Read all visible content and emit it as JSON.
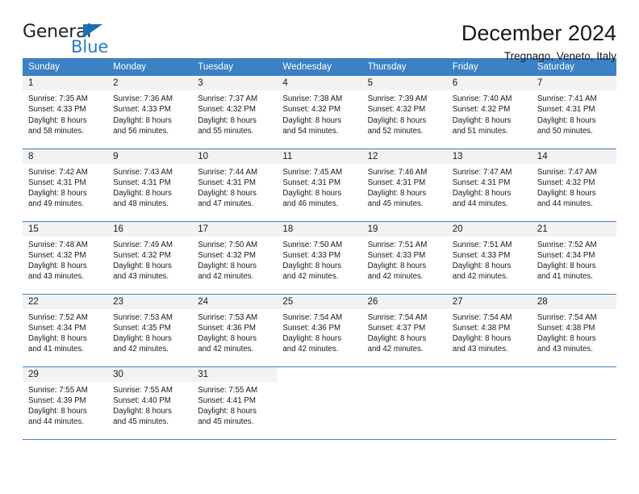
{
  "brand": {
    "name_part1": "General",
    "name_part2": "Blue",
    "triangle_icon": "triangle-icon",
    "accent_color": "#1f7fc4"
  },
  "header": {
    "title": "December 2024",
    "subtitle": "Tregnago, Veneto, Italy"
  },
  "theme": {
    "header_row_bg": "#3b81c4",
    "daynum_bg": "#f2f2f2",
    "grid_line": "#3b81c4",
    "text": "#1a1a1a"
  },
  "columns": [
    "Sunday",
    "Monday",
    "Tuesday",
    "Wednesday",
    "Thursday",
    "Friday",
    "Saturday"
  ],
  "labels": {
    "sunrise_prefix": "Sunrise:",
    "sunset_prefix": "Sunset:",
    "daylight_prefix": "Daylight:"
  },
  "weeks": [
    [
      {
        "day": "1",
        "l1": "Sunrise: 7:35 AM",
        "l2": "Sunset: 4:33 PM",
        "l3": "Daylight: 8 hours",
        "l4": "and 58 minutes."
      },
      {
        "day": "2",
        "l1": "Sunrise: 7:36 AM",
        "l2": "Sunset: 4:33 PM",
        "l3": "Daylight: 8 hours",
        "l4": "and 56 minutes."
      },
      {
        "day": "3",
        "l1": "Sunrise: 7:37 AM",
        "l2": "Sunset: 4:32 PM",
        "l3": "Daylight: 8 hours",
        "l4": "and 55 minutes."
      },
      {
        "day": "4",
        "l1": "Sunrise: 7:38 AM",
        "l2": "Sunset: 4:32 PM",
        "l3": "Daylight: 8 hours",
        "l4": "and 54 minutes."
      },
      {
        "day": "5",
        "l1": "Sunrise: 7:39 AM",
        "l2": "Sunset: 4:32 PM",
        "l3": "Daylight: 8 hours",
        "l4": "and 52 minutes."
      },
      {
        "day": "6",
        "l1": "Sunrise: 7:40 AM",
        "l2": "Sunset: 4:32 PM",
        "l3": "Daylight: 8 hours",
        "l4": "and 51 minutes."
      },
      {
        "day": "7",
        "l1": "Sunrise: 7:41 AM",
        "l2": "Sunset: 4:31 PM",
        "l3": "Daylight: 8 hours",
        "l4": "and 50 minutes."
      }
    ],
    [
      {
        "day": "8",
        "l1": "Sunrise: 7:42 AM",
        "l2": "Sunset: 4:31 PM",
        "l3": "Daylight: 8 hours",
        "l4": "and 49 minutes."
      },
      {
        "day": "9",
        "l1": "Sunrise: 7:43 AM",
        "l2": "Sunset: 4:31 PM",
        "l3": "Daylight: 8 hours",
        "l4": "and 48 minutes."
      },
      {
        "day": "10",
        "l1": "Sunrise: 7:44 AM",
        "l2": "Sunset: 4:31 PM",
        "l3": "Daylight: 8 hours",
        "l4": "and 47 minutes."
      },
      {
        "day": "11",
        "l1": "Sunrise: 7:45 AM",
        "l2": "Sunset: 4:31 PM",
        "l3": "Daylight: 8 hours",
        "l4": "and 46 minutes."
      },
      {
        "day": "12",
        "l1": "Sunrise: 7:46 AM",
        "l2": "Sunset: 4:31 PM",
        "l3": "Daylight: 8 hours",
        "l4": "and 45 minutes."
      },
      {
        "day": "13",
        "l1": "Sunrise: 7:47 AM",
        "l2": "Sunset: 4:31 PM",
        "l3": "Daylight: 8 hours",
        "l4": "and 44 minutes."
      },
      {
        "day": "14",
        "l1": "Sunrise: 7:47 AM",
        "l2": "Sunset: 4:32 PM",
        "l3": "Daylight: 8 hours",
        "l4": "and 44 minutes."
      }
    ],
    [
      {
        "day": "15",
        "l1": "Sunrise: 7:48 AM",
        "l2": "Sunset: 4:32 PM",
        "l3": "Daylight: 8 hours",
        "l4": "and 43 minutes."
      },
      {
        "day": "16",
        "l1": "Sunrise: 7:49 AM",
        "l2": "Sunset: 4:32 PM",
        "l3": "Daylight: 8 hours",
        "l4": "and 43 minutes."
      },
      {
        "day": "17",
        "l1": "Sunrise: 7:50 AM",
        "l2": "Sunset: 4:32 PM",
        "l3": "Daylight: 8 hours",
        "l4": "and 42 minutes."
      },
      {
        "day": "18",
        "l1": "Sunrise: 7:50 AM",
        "l2": "Sunset: 4:33 PM",
        "l3": "Daylight: 8 hours",
        "l4": "and 42 minutes."
      },
      {
        "day": "19",
        "l1": "Sunrise: 7:51 AM",
        "l2": "Sunset: 4:33 PM",
        "l3": "Daylight: 8 hours",
        "l4": "and 42 minutes."
      },
      {
        "day": "20",
        "l1": "Sunrise: 7:51 AM",
        "l2": "Sunset: 4:33 PM",
        "l3": "Daylight: 8 hours",
        "l4": "and 42 minutes."
      },
      {
        "day": "21",
        "l1": "Sunrise: 7:52 AM",
        "l2": "Sunset: 4:34 PM",
        "l3": "Daylight: 8 hours",
        "l4": "and 41 minutes."
      }
    ],
    [
      {
        "day": "22",
        "l1": "Sunrise: 7:52 AM",
        "l2": "Sunset: 4:34 PM",
        "l3": "Daylight: 8 hours",
        "l4": "and 41 minutes."
      },
      {
        "day": "23",
        "l1": "Sunrise: 7:53 AM",
        "l2": "Sunset: 4:35 PM",
        "l3": "Daylight: 8 hours",
        "l4": "and 42 minutes."
      },
      {
        "day": "24",
        "l1": "Sunrise: 7:53 AM",
        "l2": "Sunset: 4:36 PM",
        "l3": "Daylight: 8 hours",
        "l4": "and 42 minutes."
      },
      {
        "day": "25",
        "l1": "Sunrise: 7:54 AM",
        "l2": "Sunset: 4:36 PM",
        "l3": "Daylight: 8 hours",
        "l4": "and 42 minutes."
      },
      {
        "day": "26",
        "l1": "Sunrise: 7:54 AM",
        "l2": "Sunset: 4:37 PM",
        "l3": "Daylight: 8 hours",
        "l4": "and 42 minutes."
      },
      {
        "day": "27",
        "l1": "Sunrise: 7:54 AM",
        "l2": "Sunset: 4:38 PM",
        "l3": "Daylight: 8 hours",
        "l4": "and 43 minutes."
      },
      {
        "day": "28",
        "l1": "Sunrise: 7:54 AM",
        "l2": "Sunset: 4:38 PM",
        "l3": "Daylight: 8 hours",
        "l4": "and 43 minutes."
      }
    ],
    [
      {
        "day": "29",
        "l1": "Sunrise: 7:55 AM",
        "l2": "Sunset: 4:39 PM",
        "l3": "Daylight: 8 hours",
        "l4": "and 44 minutes."
      },
      {
        "day": "30",
        "l1": "Sunrise: 7:55 AM",
        "l2": "Sunset: 4:40 PM",
        "l3": "Daylight: 8 hours",
        "l4": "and 45 minutes."
      },
      {
        "day": "31",
        "l1": "Sunrise: 7:55 AM",
        "l2": "Sunset: 4:41 PM",
        "l3": "Daylight: 8 hours",
        "l4": "and 45 minutes."
      },
      {
        "day": "",
        "l1": "",
        "l2": "",
        "l3": "",
        "l4": ""
      },
      {
        "day": "",
        "l1": "",
        "l2": "",
        "l3": "",
        "l4": ""
      },
      {
        "day": "",
        "l1": "",
        "l2": "",
        "l3": "",
        "l4": ""
      },
      {
        "day": "",
        "l1": "",
        "l2": "",
        "l3": "",
        "l4": ""
      }
    ]
  ]
}
